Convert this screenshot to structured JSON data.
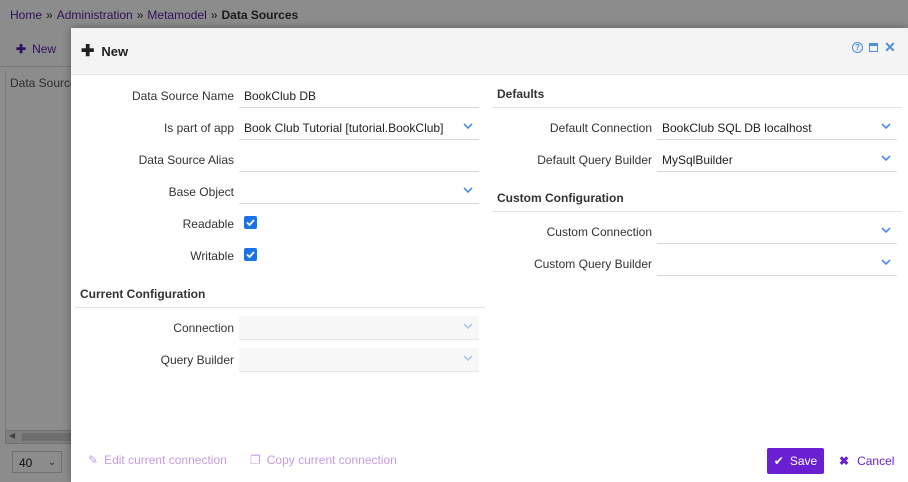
{
  "breadcrumb": {
    "items": [
      "Home",
      "Administration",
      "Metamodel"
    ],
    "separator": "»",
    "current": "Data Sources"
  },
  "background": {
    "new_label": "New",
    "column_header": "Data Source",
    "page_size": "40"
  },
  "dialog": {
    "title": "New",
    "icons": [
      "help-icon",
      "maximize-icon",
      "close-icon"
    ],
    "left": {
      "data_source_name": {
        "label": "Data Source Name",
        "value": "BookClub DB"
      },
      "is_part_of_app": {
        "label": "Is part of app",
        "value": "Book Club Tutorial [tutorial.BookClub]"
      },
      "data_source_alias": {
        "label": "Data Source Alias",
        "value": ""
      },
      "base_object": {
        "label": "Base Object",
        "value": ""
      },
      "readable": {
        "label": "Readable",
        "checked": true
      },
      "writable": {
        "label": "Writable",
        "checked": true
      },
      "current_configuration": {
        "title": "Current Configuration",
        "connection": {
          "label": "Connection",
          "value": ""
        },
        "query_builder": {
          "label": "Query Builder",
          "value": ""
        }
      }
    },
    "right": {
      "defaults": {
        "title": "Defaults",
        "default_connection": {
          "label": "Default Connection",
          "value": "BookClub SQL DB localhost"
        },
        "default_query_builder": {
          "label": "Default Query Builder",
          "value": "MySqlBuilder"
        }
      },
      "custom_configuration": {
        "title": "Custom Configuration",
        "custom_connection": {
          "label": "Custom Connection",
          "value": ""
        },
        "custom_query_builder": {
          "label": "Custom Query Builder",
          "value": ""
        }
      }
    },
    "footer": {
      "edit_connection": "Edit current connection",
      "copy_connection": "Copy current connection",
      "save": "Save",
      "cancel": "Cancel"
    }
  },
  "colors": {
    "accent": "#6a1fd0",
    "link": "#5a1ea8",
    "icon_blue": "#4a90e2",
    "checkbox": "#1a73e8",
    "muted_link": "#c79be0"
  }
}
